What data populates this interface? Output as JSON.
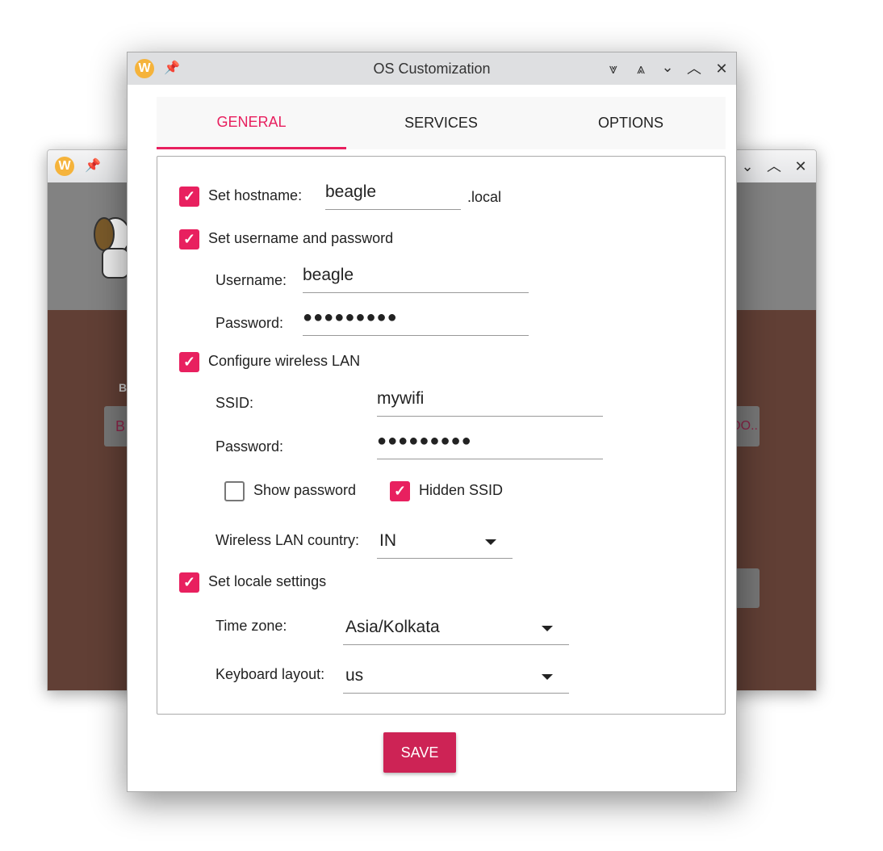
{
  "background_window": {
    "controls": [
      "minimize",
      "maximize",
      "close"
    ],
    "partial_label": "B",
    "partial_button_left": "B",
    "partial_button_right": "OO.."
  },
  "window": {
    "title": "OS Customization",
    "controls": [
      "keep-below",
      "keep-above",
      "minimize",
      "maximize",
      "close"
    ]
  },
  "tabs": [
    {
      "label": "GENERAL",
      "active": true
    },
    {
      "label": "SERVICES",
      "active": false
    },
    {
      "label": "OPTIONS",
      "active": false
    }
  ],
  "general": {
    "hostname": {
      "label": "Set hostname:",
      "checked": true,
      "value": "beagle",
      "suffix": ".local"
    },
    "user": {
      "label": "Set username and password",
      "checked": true,
      "username_label": "Username:",
      "username": "beagle",
      "password_label": "Password:",
      "password": "●●●●●●●●●"
    },
    "wlan": {
      "label": "Configure wireless LAN",
      "checked": true,
      "ssid_label": "SSID:",
      "ssid": "mywifi",
      "password_label": "Password:",
      "password": "●●●●●●●●●",
      "show_password": {
        "label": "Show password",
        "checked": false
      },
      "hidden_ssid": {
        "label": "Hidden SSID",
        "checked": true
      },
      "country_label": "Wireless LAN country:",
      "country": "IN"
    },
    "locale": {
      "label": "Set locale settings",
      "checked": true,
      "timezone_label": "Time zone:",
      "timezone": "Asia/Kolkata",
      "keyboard_label": "Keyboard layout:",
      "keyboard": "us"
    }
  },
  "save_label": "SAVE",
  "colors": {
    "accent": "#e8205f",
    "save": "#cd2355",
    "bg_brown": "#613f35",
    "bg_gray": "#828282"
  }
}
